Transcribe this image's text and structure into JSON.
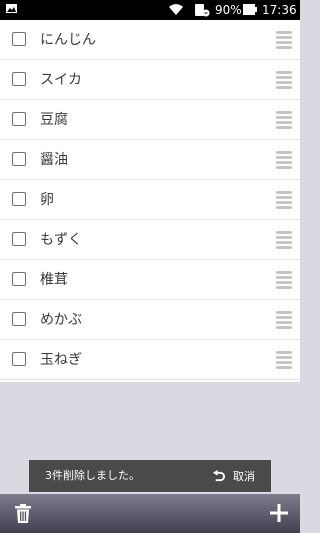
{
  "status_bar": {
    "battery_percent": "90%",
    "time": "17:36",
    "icons": [
      "gallery-icon",
      "wifi-icon",
      "sim-icon",
      "battery-icon"
    ]
  },
  "items": [
    {
      "label": "にんじん",
      "checked": false
    },
    {
      "label": "スイカ",
      "checked": false
    },
    {
      "label": "豆腐",
      "checked": false
    },
    {
      "label": "醤油",
      "checked": false
    },
    {
      "label": "卵",
      "checked": false
    },
    {
      "label": "もずく",
      "checked": false
    },
    {
      "label": "椎茸",
      "checked": false
    },
    {
      "label": "めかぶ",
      "checked": false
    },
    {
      "label": "玉ねぎ",
      "checked": false
    }
  ],
  "snackbar": {
    "message": "3件削除しました。",
    "undo_label": "取消"
  },
  "bottom_bar": {
    "left_icon": "trash-icon",
    "right_icon": "add-icon"
  }
}
